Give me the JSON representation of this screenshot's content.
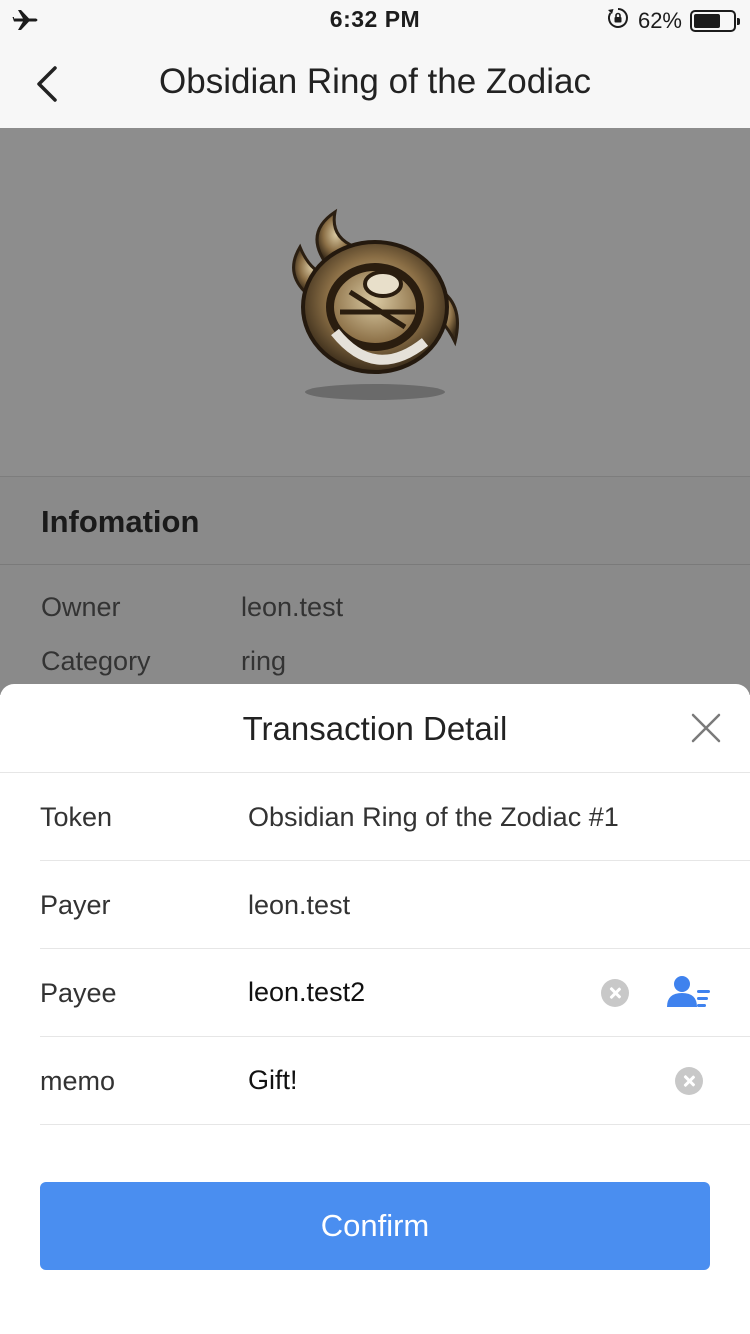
{
  "status_bar": {
    "time": "6:32 PM",
    "battery_percent": "62%",
    "battery_level": 0.62,
    "left_icon": "airplane-icon",
    "lock_icon": "rotation-lock-icon"
  },
  "nav": {
    "title": "Obsidian Ring of the Zodiac",
    "back_icon": "chevron-left-icon"
  },
  "info": {
    "header": "Infomation",
    "rows": [
      {
        "key": "Owner",
        "value": "leon.test"
      },
      {
        "key": "Category",
        "value": "ring"
      }
    ]
  },
  "sheet": {
    "title": "Transaction Detail",
    "token_label": "Token",
    "token_value": "Obsidian Ring of the Zodiac #1",
    "payer_label": "Payer",
    "payer_value": "leon.test",
    "payee_label": "Payee",
    "payee_value": "leon.test2",
    "memo_label": "memo",
    "memo_value": "Gift!",
    "confirm_label": "Confirm"
  },
  "colors": {
    "accent": "#4a8ef0",
    "overlay": "#8a8a8a",
    "divider": "#e6e6e6"
  }
}
